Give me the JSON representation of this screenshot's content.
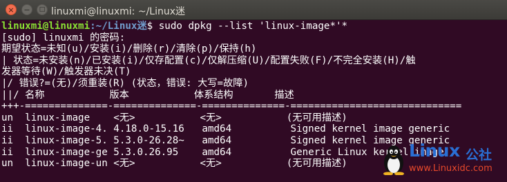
{
  "window": {
    "title": "linuxmi@linuxmi: ~/Linux迷",
    "close_glyph": "×",
    "minimize_glyph": "−",
    "maximize_glyph": "□"
  },
  "prompt": {
    "user_host": "linuxmi@linuxmi",
    "path": ":~/Linux迷",
    "symbol": "$",
    "command": " sudo dpkg --list 'linux-image*'*"
  },
  "output_lines": [
    "[sudo] linuxmi 的密码:",
    "期望状态=未知(u)/安装(i)/删除(r)/清除(p)/保持(h)",
    "| 状态=未安装(n)/已安装(i)/仅存配置(c)/仅解压缩(U)/配置失败(F)/不完全安装(H)/触",
    "发器等待(W)/触发器未决(T)",
    "|/ 错误?=(无)/须重装(R) (状态，错误: 大写=故障)",
    "||/ 名称           版本           体系结构       描述",
    "+++-==============-==============-==============-=============================",
    "un  linux-image    <无>           <无>           (无可用描述)",
    "ii  linux-image-4. 4.18.0-15.16   amd64          Signed kernel image generic",
    "ii  linux-image-5. 5.3.0-26.28~   amd64          Signed kernel image generic",
    "ii  linux-image-ge 5.3.0.26.95    amd64          Generic Linux kernel image",
    "un  linux-image-un <无>           <无>           (无可用描述)"
  ],
  "watermark": {
    "brand": "Linux",
    "brand_cn": "公社",
    "url": "www.Linuxidc.com"
  },
  "colors": {
    "background": "#300a24",
    "prompt_user": "#8ae234",
    "prompt_path": "#729fcf",
    "text": "#ffffff",
    "watermark_blue": "#2a6fd4",
    "watermark_red": "#e8492b"
  }
}
